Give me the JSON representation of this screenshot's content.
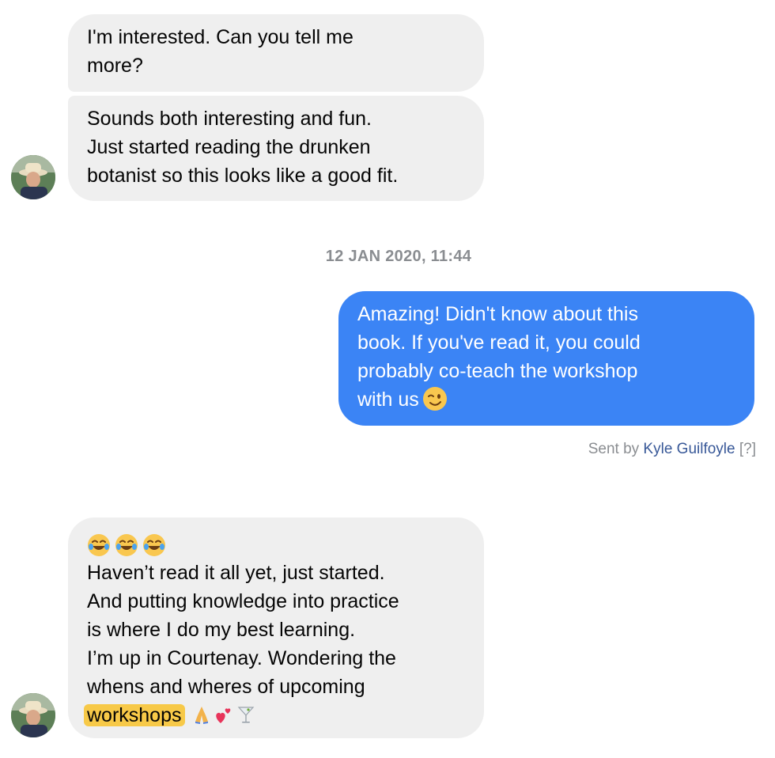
{
  "messages": [
    {
      "direction": "incoming",
      "lines": [
        "I'm interested. Can you tell me",
        "more?"
      ]
    },
    {
      "direction": "incoming",
      "lines": [
        "Sounds both interesting and fun.",
        "Just started reading the drunken",
        "botanist so this looks like a good fit."
      ]
    },
    {
      "direction": "outgoing",
      "lines": [
        "Amazing! Didn't know about this",
        "book. If you've read it, you could",
        "probably co-teach the workshop",
        "with us"
      ]
    },
    {
      "direction": "incoming",
      "lines": [
        "Haven’t read it all yet, just started.",
        "And putting knowledge into practice",
        "is where I do my best learning.",
        "I’m up in Courtenay. Wondering the",
        "whens and wheres of upcoming"
      ],
      "highlighted_word": "workshops"
    }
  ],
  "timestamp": "12 JAN 2020, 11:44",
  "sent_by": {
    "prefix": "Sent by",
    "name": "Kyle Guilfoyle",
    "help": "[?]"
  },
  "icons": {
    "avatar": "user-avatar",
    "wink": "winking-face-emoji",
    "laugh": "tears-of-joy-emoji",
    "pray": "folded-hands-emoji",
    "hearts": "two-hearts-emoji",
    "cocktail": "cocktail-glass-emoji"
  },
  "colors": {
    "incoming_bubble": "#efefef",
    "outgoing_bubble": "#3b84f5",
    "highlight": "#f7c948",
    "link": "#385898"
  }
}
